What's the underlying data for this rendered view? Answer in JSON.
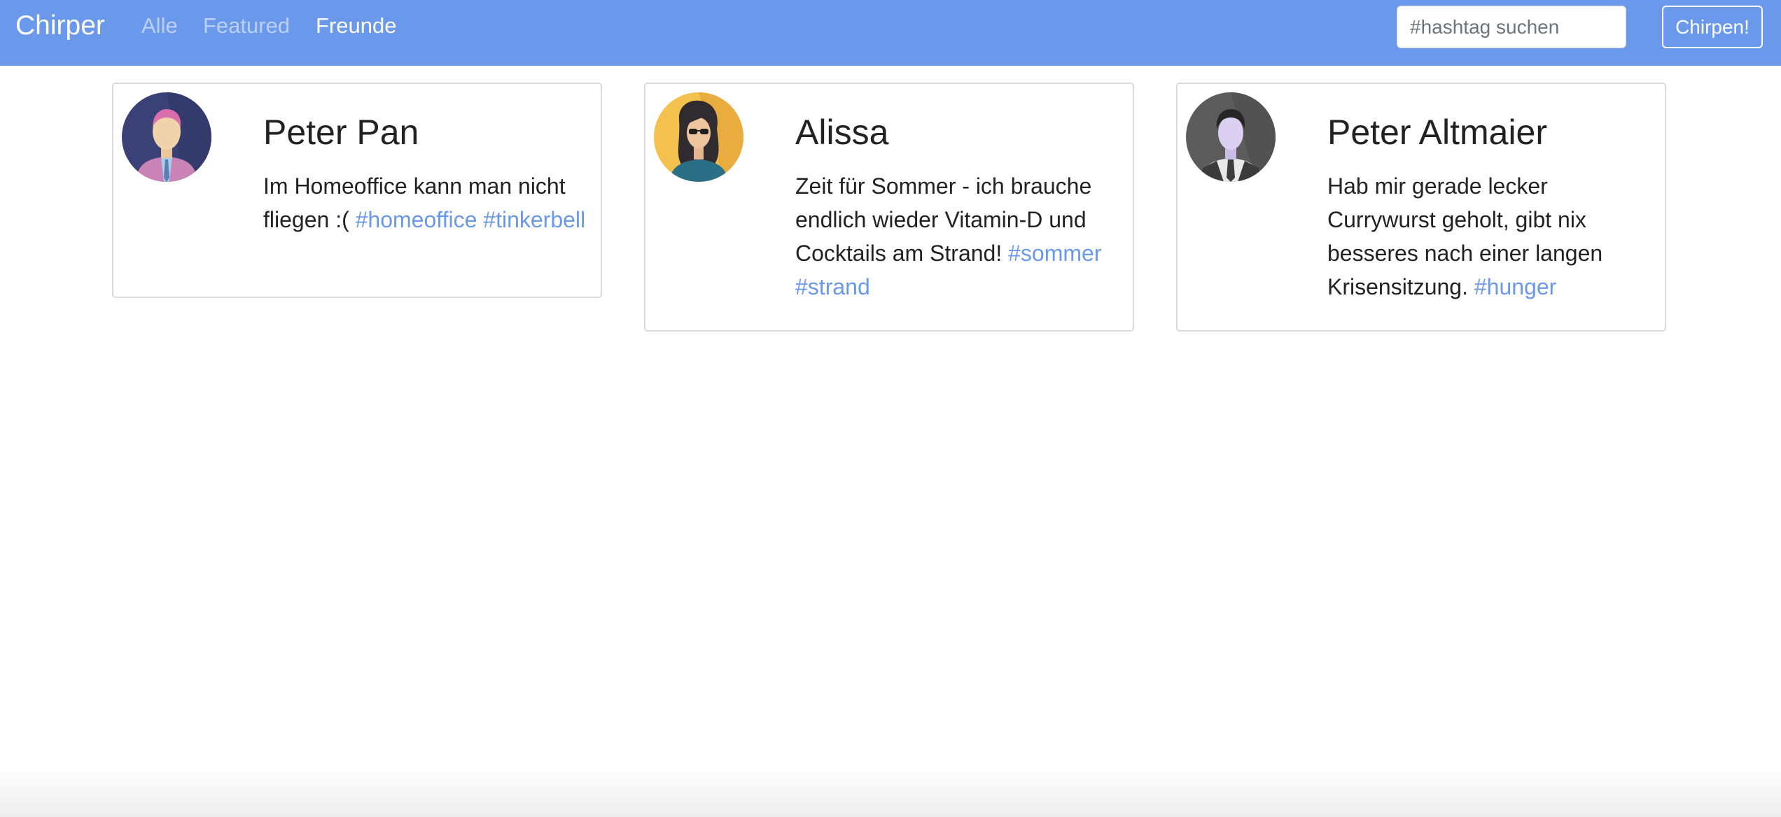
{
  "navbar": {
    "brand": "Chirper",
    "links": [
      {
        "label": "Alle",
        "active": false
      },
      {
        "label": "Featured",
        "active": false
      },
      {
        "label": "Freunde",
        "active": true
      }
    ],
    "search_placeholder": "#hashtag suchen",
    "chirp_button": "Chirpen!"
  },
  "colors": {
    "navbar_bg": "#6a98ea",
    "hashtag": "#6a98ea",
    "text": "#222222"
  },
  "posts": [
    {
      "name": "Peter Pan",
      "avatar_icon": "man-pink-shirt-avatar-icon",
      "text": "Im Homeoffice kann man nicht fliegen :(",
      "hashtags": [
        "#homeoffice",
        "#tinkerbell"
      ]
    },
    {
      "name": "Alissa",
      "avatar_icon": "woman-sunglasses-avatar-icon",
      "text": "Zeit für Sommer - ich brauche endlich wieder Vitamin-D und Cocktails am Strand!",
      "hashtags": [
        "#sommer",
        "#strand"
      ]
    },
    {
      "name": "Peter Altmaier",
      "avatar_icon": "man-suit-avatar-icon",
      "text": "Hab mir gerade lecker Currywurst geholt, gibt nix besseres nach einer langen Krisensitzung.",
      "hashtags": [
        "#hunger"
      ]
    }
  ]
}
